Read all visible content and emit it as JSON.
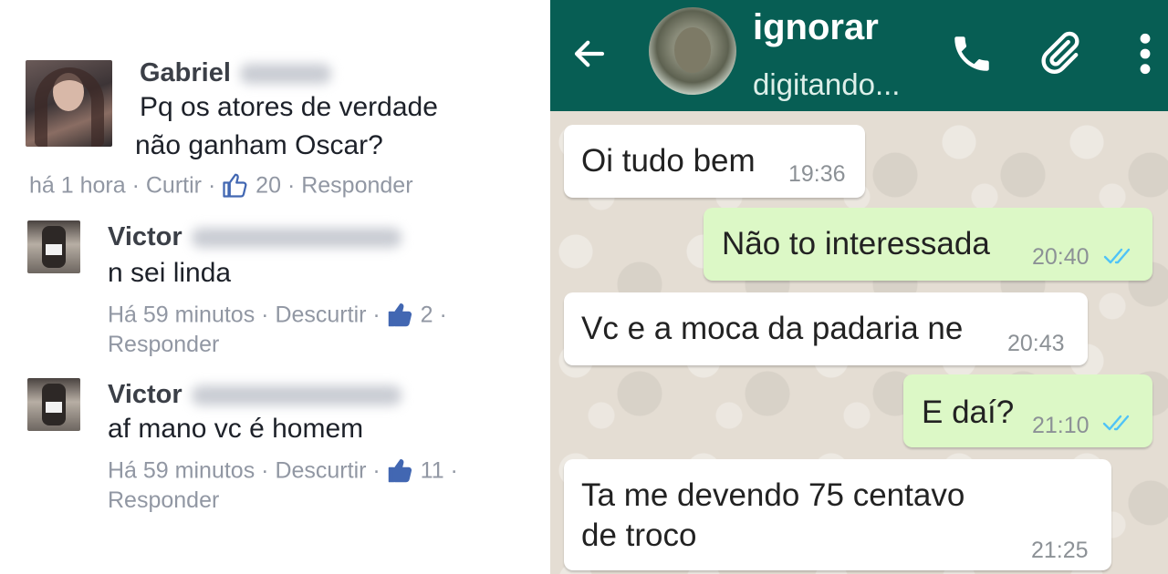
{
  "facebook": {
    "comments": [
      {
        "name": "Gabriel",
        "text_line1": "Pq os atores de verdade",
        "text_line2": "não ganham Oscar?",
        "time": "há 1 hora",
        "like": "Curtir",
        "likes": "20",
        "reply": "Responder"
      },
      {
        "name": "Victor",
        "text_line1": "n sei linda",
        "time": "Há 59 minutos",
        "like": "Descurtir",
        "likes": "2",
        "reply": "Responder"
      },
      {
        "name": "Victor",
        "text_line1": "af mano vc é homem",
        "time": "Há 59 minutos",
        "like": "Descurtir",
        "likes": "11",
        "reply": "Responder"
      }
    ],
    "separator": "·",
    "colors": {
      "meta": "#9197a3",
      "thumb": "#4267b2"
    }
  },
  "whatsapp": {
    "contact_name": "ignorar",
    "status": "digitando...",
    "icons": [
      "back-arrow-icon",
      "phone-icon",
      "paperclip-icon",
      "more-vert-icon"
    ],
    "messages": [
      {
        "direction": "in",
        "text": "Oi tudo bem",
        "time": "19:36"
      },
      {
        "direction": "out",
        "text": "Não to interessada",
        "time": "20:40",
        "read": true
      },
      {
        "direction": "in",
        "text": "Vc e a moca da padaria ne",
        "time": "20:43"
      },
      {
        "direction": "out",
        "text": "E daí?",
        "time": "21:10",
        "read": true
      },
      {
        "direction": "in",
        "text_line1": "Ta me devendo 75 centavo",
        "text_line2": "de troco",
        "time": "21:25"
      }
    ],
    "colors": {
      "header": "#075e54",
      "outgoing": "#dcf8c6",
      "incoming": "#ffffff",
      "ticks": "#4fc3f7"
    }
  }
}
